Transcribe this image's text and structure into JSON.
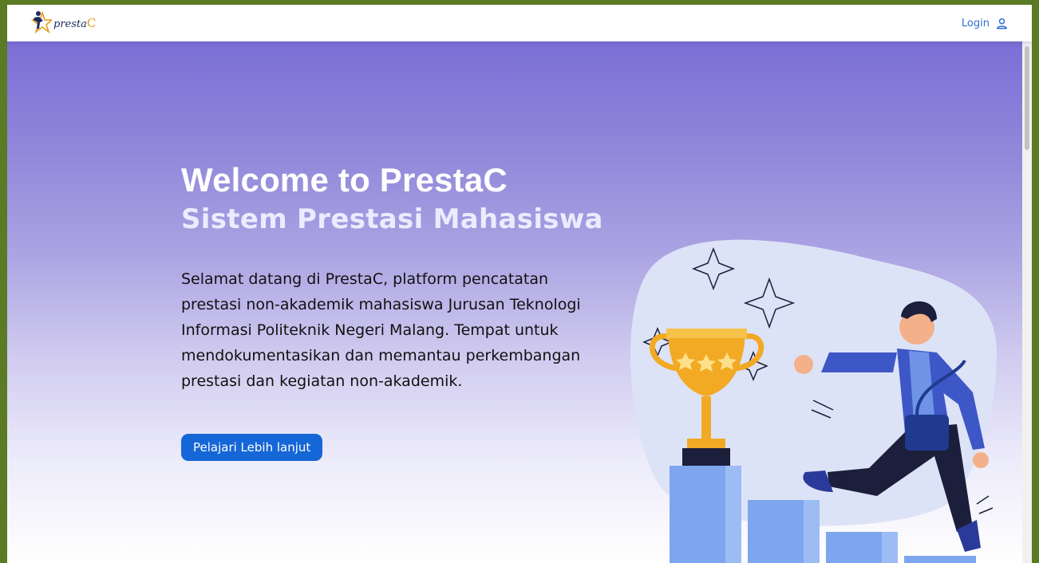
{
  "navbar": {
    "logo_text": "presta",
    "logo_c": "C",
    "login_label": "Login",
    "login_icon": "user-icon"
  },
  "hero": {
    "title": "Welcome to PrestaC",
    "subtitle": "Sistem Prestasi Mahasiswa",
    "description": "Selamat datang di PrestaC, platform pencatatan prestasi non-akademik mahasiswa Jurusan Teknologi Informasi Politeknik Negeri Malang. Tempat untuk mendokumentasikan dan memantau perkembangan prestasi dan kegiatan non-akademik.",
    "cta_label": "Pelajari Lebih lanjut"
  },
  "colors": {
    "frame": "#5a7a24",
    "gradient_top": "#7b6fd6",
    "cta": "#1566d6",
    "login": "#2f6fd3"
  }
}
